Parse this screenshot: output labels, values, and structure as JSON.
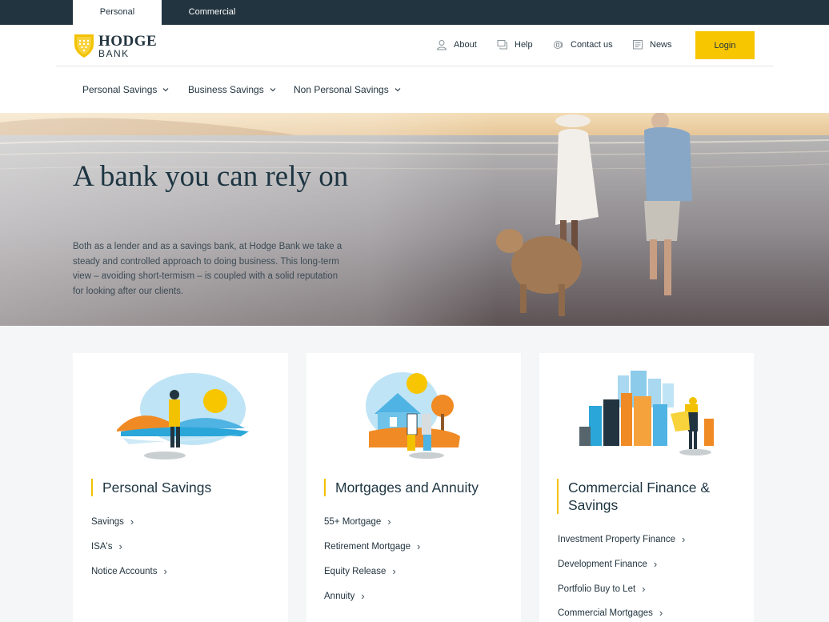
{
  "top_tabs": {
    "personal": "Personal",
    "commercial": "Commercial"
  },
  "logo": {
    "line1": "HODGE",
    "line2": "BANK"
  },
  "header_links": {
    "about": "About",
    "help": "Help",
    "contact": "Contact us",
    "news": "News"
  },
  "login_label": "Login",
  "main_nav": [
    {
      "label": "Personal Savings"
    },
    {
      "label": "Business Savings"
    },
    {
      "label": "Non Personal Savings"
    }
  ],
  "hero": {
    "title": "A bank you can rely on",
    "text": "Both as a lender and as a savings bank, at Hodge Bank we take a steady and controlled approach to doing business. This long-term view – avoiding short-termism – is coupled with a solid reputation for looking after our clients."
  },
  "cards": [
    {
      "title": "Personal Savings",
      "links": [
        "Savings",
        "ISA's",
        "Notice Accounts"
      ]
    },
    {
      "title": "Mortgages and Annuity",
      "links": [
        "55+ Mortgage",
        "Retirement Mortgage",
        "Equity Release",
        "Annuity"
      ]
    },
    {
      "title": "Commercial Finance & Savings",
      "links": [
        "Investment Property Finance",
        "Development Finance",
        "Portfolio Buy to Let",
        "Commercial Mortgages"
      ]
    }
  ],
  "colors": {
    "navy": "#22343f",
    "accent_yellow": "#f7c600",
    "white": "#ffffff"
  },
  "icons": [
    "user-icon",
    "help-chat-icon",
    "phone-icon",
    "news-icon",
    "chevron-down-icon",
    "chevron-right-icon"
  ]
}
